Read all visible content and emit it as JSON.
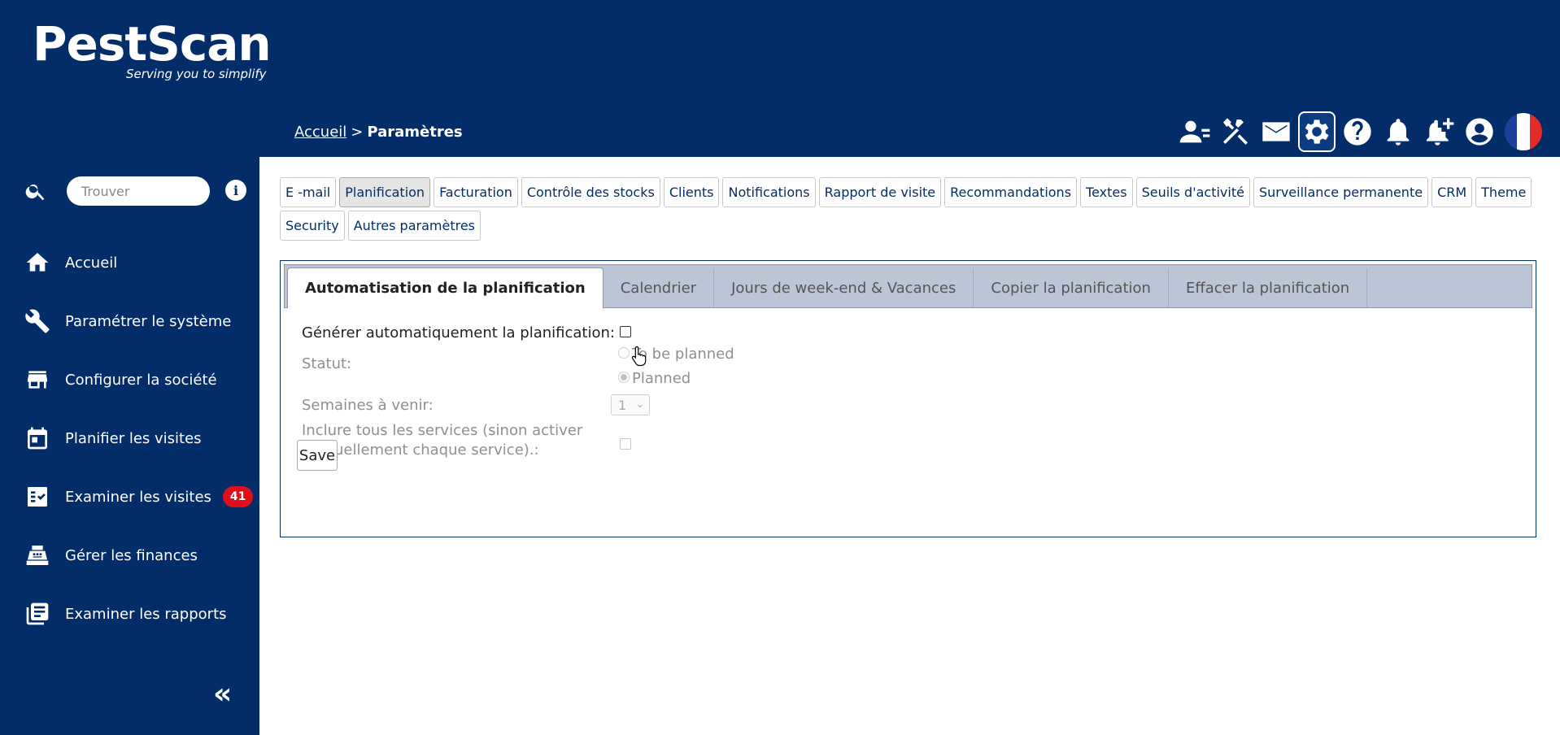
{
  "brand": {
    "name": "PestScan",
    "tagline": "Serving you to simplify"
  },
  "breadcrumb": {
    "home": "Accueil",
    "separator": ">",
    "current": "Paramètres"
  },
  "header_icons": [
    "user-switch-icon",
    "tools-icon",
    "mail-icon",
    "gear-icon",
    "help-icon",
    "bell-icon",
    "bell-plus-icon",
    "account-icon",
    "france-flag-icon"
  ],
  "search": {
    "placeholder": "Trouver",
    "info": "i"
  },
  "nav": [
    {
      "label": "Accueil",
      "icon": "home-icon"
    },
    {
      "label": "Paramétrer le système",
      "icon": "wrench-icon"
    },
    {
      "label": "Configurer la société",
      "icon": "store-icon"
    },
    {
      "label": "Planifier les visites",
      "icon": "calendar-icon"
    },
    {
      "label": "Examiner les visites",
      "icon": "checklist-icon",
      "badge": "41"
    },
    {
      "label": "Gérer les finances",
      "icon": "cash-register-icon"
    },
    {
      "label": "Examiner les rapports",
      "icon": "reports-icon"
    }
  ],
  "collapse_label": "«",
  "top_tabs": [
    "E -mail",
    "Planification",
    "Facturation",
    "Contrôle des stocks",
    "Clients",
    "Notifications",
    "Rapport de visite",
    "Recommandations",
    "Textes",
    "Seuils d'activité",
    "Surveillance permanente",
    "CRM",
    "Theme",
    "Security",
    "Autres paramètres"
  ],
  "active_top_tab": "Planification",
  "sub_tabs": [
    "Automatisation de la planification",
    "Calendrier",
    "Jours de week-end & Vacances",
    "Copier la planification",
    "Effacer la planification"
  ],
  "form": {
    "auto_label": "Générer automatiquement la planification:",
    "status_label": "Statut:",
    "status_options": [
      "To be planned",
      "Planned"
    ],
    "status_selected": "Planned",
    "weeks_label": "Semaines à venir:",
    "weeks_value": "1",
    "include_label_line1": "Inclure tous les services (sinon activer",
    "include_label_line2": "manuellement chaque service).:",
    "save_label": "Save"
  },
  "colors": {
    "navy": "#032d69",
    "badge": "#e00f1c",
    "subtab_bar": "#bcc5d5"
  }
}
